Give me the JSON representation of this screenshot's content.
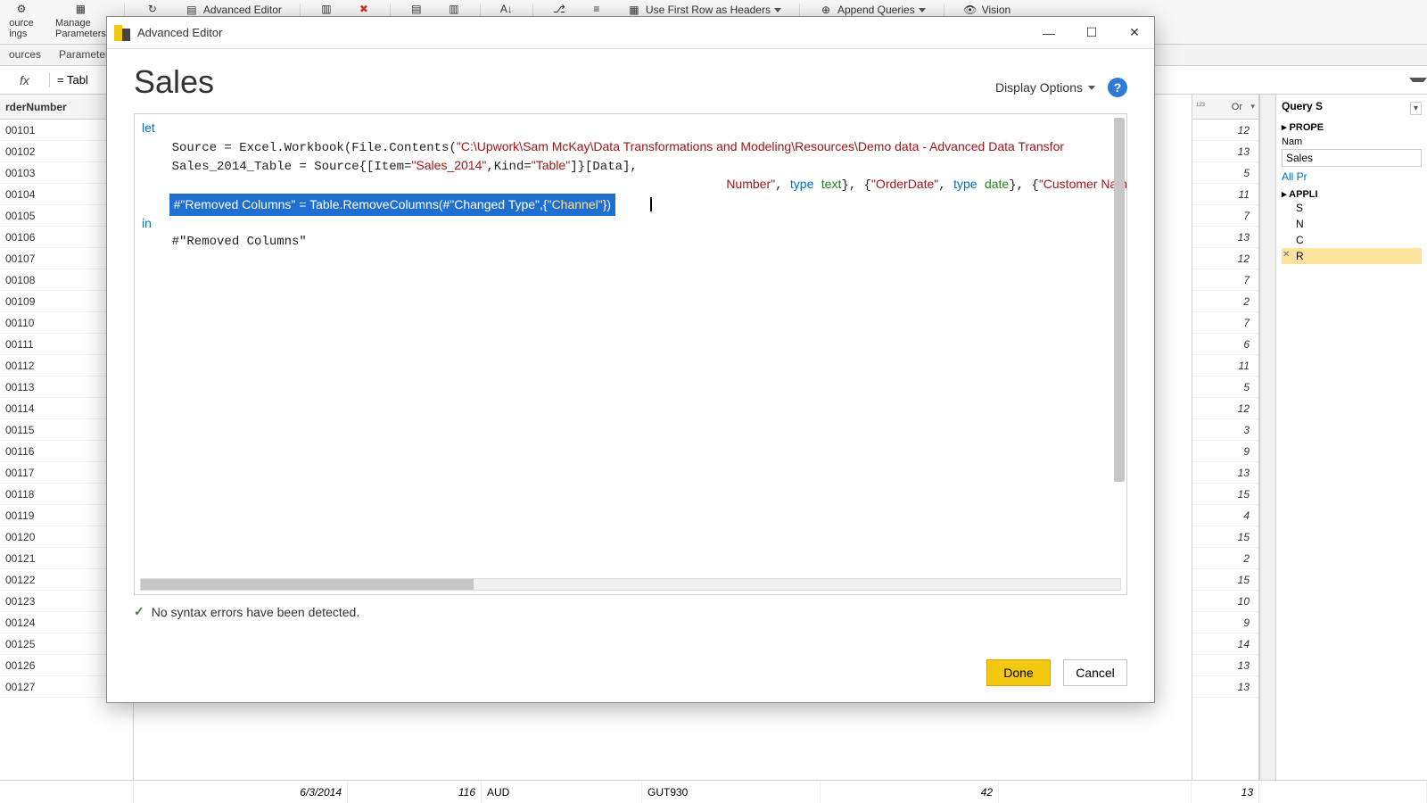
{
  "ribbon": {
    "source_btn": "ource\nings",
    "manage_params": "Manage\nParameters",
    "advanced_editor": "Advanced Editor",
    "use_first_row": "Use First Row as Headers",
    "append_queries": "Append Queries",
    "vision": "Vision",
    "tab_sources": "ources",
    "tab_params": "Parameters"
  },
  "formula_bar": {
    "fx": "fx",
    "value": "= Tabl"
  },
  "grid_header": "rderNumber",
  "grid_rows": [
    "00101",
    "00102",
    "00103",
    "00104",
    "00105",
    "00106",
    "00107",
    "00108",
    "00109",
    "00110",
    "00111",
    "00112",
    "00113",
    "00114",
    "00115",
    "00116",
    "00117",
    "00118",
    "00119",
    "00120",
    "00121",
    "00122",
    "00123",
    "00124",
    "00125",
    "00126",
    "00127"
  ],
  "numcol_header": "Or",
  "numcol_values": [
    "12",
    "13",
    "5",
    "11",
    "7",
    "13",
    "12",
    "7",
    "2",
    "7",
    "6",
    "11",
    "5",
    "12",
    "3",
    "9",
    "13",
    "15",
    "4",
    "15",
    "2",
    "15",
    "10",
    "9",
    "14",
    "13",
    "13"
  ],
  "bottom": {
    "c1": "6/3/2014",
    "c2": "116",
    "c3": "AUD",
    "c4": "GUT930",
    "c5": "42",
    "c6": "13"
  },
  "right_panel": {
    "query_settings": "Query S",
    "prop": "PROPE",
    "name_lbl": "Nam",
    "name_val": "Sales",
    "all_props": "All Pr",
    "applied": "APPLI",
    "steps": [
      "S",
      "N",
      "C"
    ],
    "step_sel": "R"
  },
  "dialog": {
    "title": "Advanced Editor",
    "heading": "Sales",
    "display_options": "Display Options",
    "status": "No syntax errors have been detected.",
    "done": "Done",
    "cancel": "Cancel",
    "code": {
      "let": "let",
      "l1a": "    Source = Excel.Workbook(File.Contents(",
      "l1s": "\"C:\\Upwork\\Sam McKay\\Data Transformations and Modeling\\Resources\\Demo data - Advanced Data Transfor",
      "l2a": "    Sales_2014_Table = Source{[Item=",
      "l2s1": "\"Sales_2014\"",
      "l2b": ",Kind=",
      "l2s2": "\"Table\"",
      "l2c": "]}[Data],",
      "l3a": "Number\"",
      "l3b": ", ",
      "l3kw": "type",
      "l3tn": "text",
      "l3c": "}, {",
      "l3d": "\"OrderDate\"",
      "l3e": ", ",
      "l3kw2": "type",
      "l3tn2": "date",
      "l3f": "}, {",
      "l3g": "\"Customer Name Inde",
      "hl1": "#\"Removed Columns\" = Table.RemoveColumns(#\"Changed Type\",{",
      "hl_s": "\"Channel\"",
      "hl2": "})",
      "in": "in",
      "l6": "    #\"Removed Columns\""
    }
  }
}
